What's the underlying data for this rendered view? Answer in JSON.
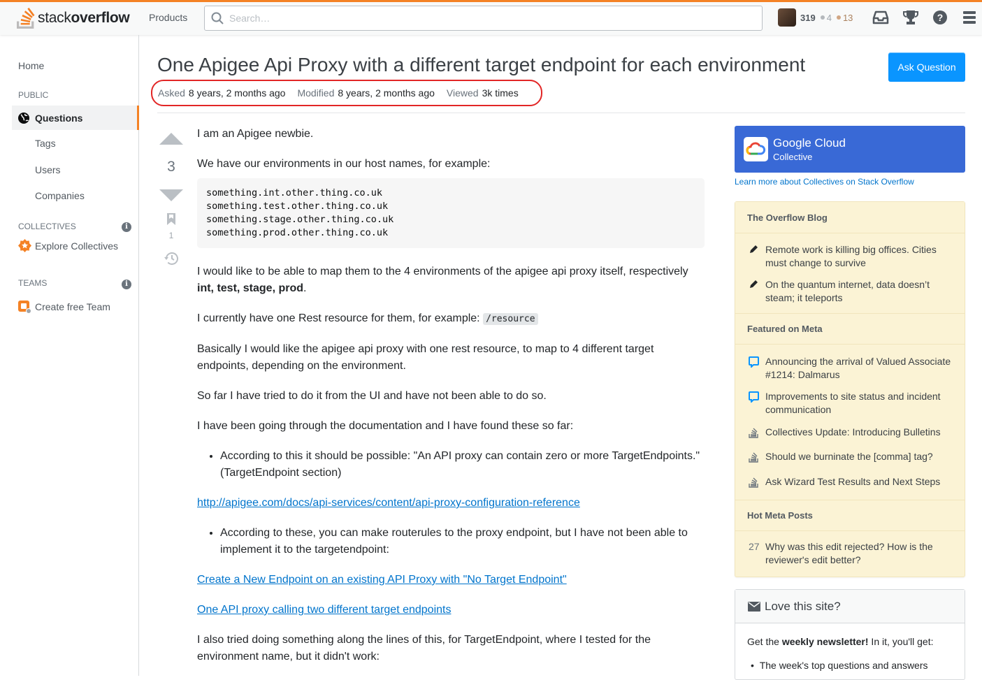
{
  "topbar": {
    "logo_light": "stack",
    "logo_bold": "overflow",
    "products": "Products",
    "search_placeholder": "Search…",
    "reputation": "319",
    "silver": "4",
    "bronze": "13"
  },
  "leftnav": {
    "home": "Home",
    "public": "PUBLIC",
    "questions": "Questions",
    "tags": "Tags",
    "users": "Users",
    "companies": "Companies",
    "collectives": "COLLECTIVES",
    "explore": "Explore Collectives",
    "teams": "TEAMS",
    "create_team": "Create free Team"
  },
  "question": {
    "title": "One Apigee Api Proxy with a different target endpoint for each environment",
    "ask_button": "Ask Question",
    "asked_label": "Asked",
    "asked_value": "8 years, 2 months ago",
    "modified_label": "Modified",
    "modified_value": "8 years, 2 months ago",
    "viewed_label": "Viewed",
    "viewed_value": "3k times",
    "votes": "3",
    "bookmarks": "1",
    "body": {
      "p1": "I am an Apigee newbie.",
      "p2": "We have our environments in our host names, for example:",
      "code": "something.int.other.thing.co.uk\nsomething.test.other.thing.co.uk\nsomething.stage.other.thing.co.uk\nsomething.prod.other.thing.co.uk",
      "p3a": "I would like to be able to map them to the 4 environments of the apigee api proxy itself, respectively ",
      "p3b": "int, test, stage, prod",
      "p3c": ".",
      "p4a": "I currently have one Rest resource for them, for example: ",
      "p4code": "/resource",
      "p5": "Basically I would like the apigee api proxy with one rest resource, to map to 4 different target endpoints, depending on the environment.",
      "p6": "So far I have tried to do it from the UI and have not been able to do so.",
      "p7": "I have been going through the documentation and I have found these so far:",
      "li1": "According to this it should be possible: \"An API proxy can contain zero or more TargetEndpoints.\" (TargetEndpoint section)",
      "link1": "http://apigee.com/docs/api-services/content/api-proxy-configuration-reference",
      "li2": "According to these, you can make routerules to the proxy endpoint, but I have not been able to implement it to the targetendpoint:",
      "link2": "Create a New Endpoint on an existing API Proxy with \"No Target Endpoint\"",
      "link3": "One API proxy calling two different target endpoints",
      "p8": "I also tried doing something along the lines of this, for TargetEndpoint, where I tested for the environment name, but it didn't work:"
    }
  },
  "sidebar": {
    "collective_name": "Google Cloud",
    "collective_sub": "Collective",
    "collective_link": "Learn more about Collectives on Stack Overflow",
    "blog_header": "The Overflow Blog",
    "blog_items": [
      "Remote work is killing big offices. Cities must change to survive",
      "On the quantum internet, data doesn’t steam; it teleports"
    ],
    "meta_header": "Featured on Meta",
    "meta_items": [
      "Announcing the arrival of Valued Associate #1214: Dalmarus",
      "Improvements to site status and incident communication",
      "Collectives Update: Introducing Bulletins",
      "Should we burninate the [comma] tag?",
      "Ask Wizard Test Results and Next Steps"
    ],
    "hot_header": "Hot Meta Posts",
    "hot_count": "27",
    "hot_item": "Why was this edit rejected? How is the reviewer's edit better?",
    "love_title": "Love this site?",
    "love_pre": "Get the ",
    "love_bold": "weekly newsletter!",
    "love_post": " In it, you'll get:",
    "love_li": "The week's top questions and answers"
  }
}
